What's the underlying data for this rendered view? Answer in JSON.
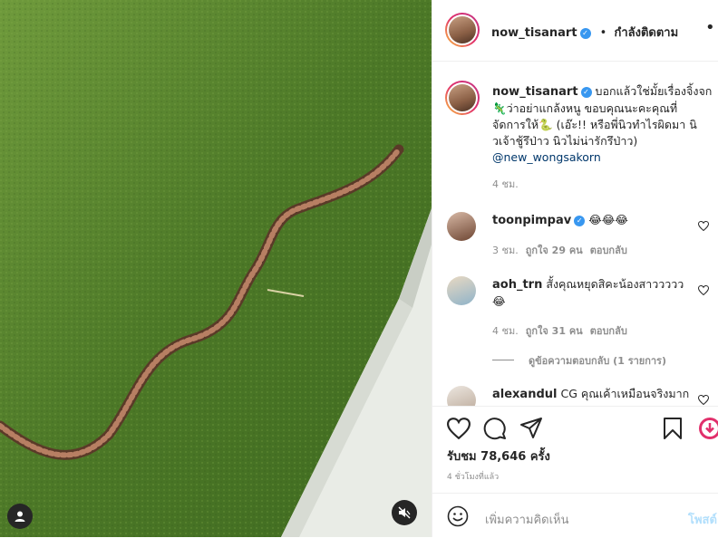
{
  "post": {
    "username": "now_tisanart",
    "follow_status": "กำลังติดตาม",
    "dot": "•",
    "more": "•••",
    "caption_line1": "บอกแล้วใช่มั้ยเรื่องจิ้งจก",
    "caption_line2": "ว่าอย่าแกล้งหนู ขอบคุณนะคะคุณที่",
    "caption_line3": "จัดการให้",
    "caption_line4": "(เอ๊ะ!! หรือพี่นิวทำไรผิดมา นิ",
    "caption_line5": "วเจ้าชู้รึป่าว นิวไม่น่ารักรึป่าว)",
    "caption_mention": "@new_wongsakorn",
    "caption_time": "4 ชม."
  },
  "comments": [
    {
      "username": "toonpimpav",
      "verified": true,
      "text": "😂😂😂",
      "time": "3 ชม.",
      "likes": "ถูกใจ 29 คน",
      "reply": "ตอบกลับ"
    },
    {
      "username": "aoh_trn",
      "verified": false,
      "text": "สั้งคุณหยุดสิคะน้องสาววววว 😂",
      "time": "4 ชม.",
      "likes": "ถูกใจ 31 คน",
      "reply": "ตอบกลับ",
      "view_replies": "ดูข้อความตอบกลับ (1 รายการ)"
    },
    {
      "username": "alexandul",
      "verified": false,
      "text": "CG คุณเค้าเหมือนจริงมาก"
    }
  ],
  "stats": {
    "likes": "รับชม 78,646 ครั้ง",
    "posted": "4 ชั่วโมงที่แล้ว"
  },
  "comment_box": {
    "placeholder": "เพิ่มความคิดเห็น",
    "post_label": "โพสต์"
  },
  "colors": {
    "grass": "#4e7a2a",
    "verified": "#3897f0",
    "link": "#00376b",
    "post_disabled": "#b2dffc"
  }
}
